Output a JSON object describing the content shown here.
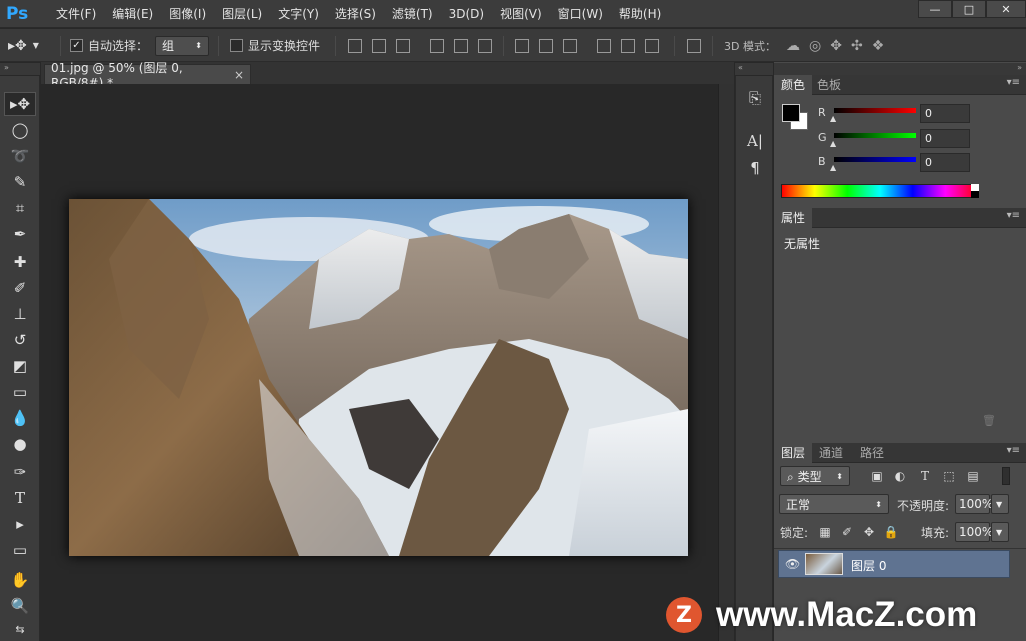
{
  "app": {
    "logo": "Ps"
  },
  "menu": [
    "文件(F)",
    "编辑(E)",
    "图像(I)",
    "图层(L)",
    "文字(Y)",
    "选择(S)",
    "滤镜(T)",
    "3D(D)",
    "视图(V)",
    "窗口(W)",
    "帮助(H)"
  ],
  "window_controls": {
    "minimize": "—",
    "maximize": "□",
    "close": "✕"
  },
  "options": {
    "auto_select_label": "自动选择：",
    "auto_select_checked": true,
    "auto_select_target": "组",
    "show_transform_label": "显示变换控件",
    "show_transform_checked": false,
    "mode_3d_label": "3D 模式："
  },
  "document": {
    "tab_title": "01.jpg @ 50% (图层 0, RGB/8#) *",
    "close": "×"
  },
  "color_panel": {
    "tabs": [
      "颜色",
      "色板"
    ],
    "active_tab": "颜色",
    "channels": [
      {
        "label": "R",
        "value": "0",
        "color": "#c00000"
      },
      {
        "label": "G",
        "value": "0",
        "color": "#00b000"
      },
      {
        "label": "B",
        "value": "0",
        "color": "#0000d0"
      }
    ]
  },
  "properties_panel": {
    "tab": "属性",
    "content": "无属性"
  },
  "layers_panel": {
    "tabs": [
      "图层",
      "通道",
      "路径"
    ],
    "active_tab": "图层",
    "filter_kind": "类型",
    "blend_mode": "正常",
    "opacity_label": "不透明度:",
    "opacity_value": "100%",
    "lock_label": "锁定:",
    "fill_label": "填充:",
    "fill_value": "100%",
    "layers": [
      {
        "name": "图层 0",
        "visible": true,
        "selected": true
      }
    ]
  },
  "watermark": {
    "badge": "Z",
    "text": "www.MacZ.com"
  }
}
